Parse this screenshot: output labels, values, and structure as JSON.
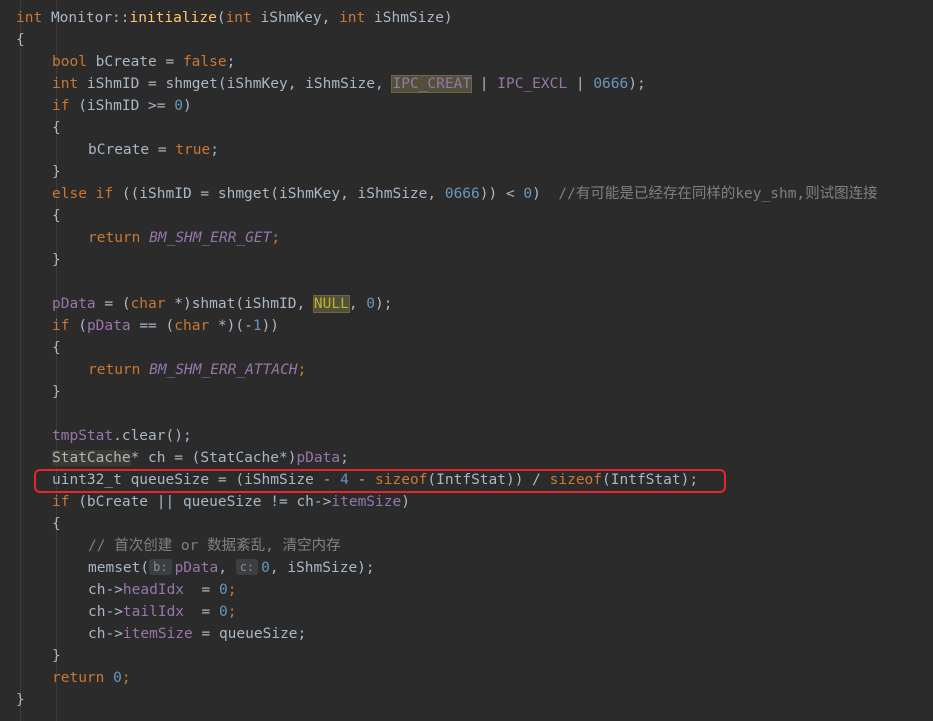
{
  "code": {
    "l1": {
      "kw1": "int",
      "cls": "Monitor::",
      "fn": "initialize",
      "p1": "(",
      "kw2": "int",
      "t1": " iShmKey, ",
      "kw3": "int",
      "t2": " iShmSize)"
    },
    "l2": {
      "t": "{"
    },
    "l3": {
      "kw": "bool",
      "t1": " bCreate = ",
      "kw2": "false",
      "t2": ";"
    },
    "l4": {
      "kw": "int",
      "t1": " iShmID = shmget(iShmKey, iShmSize, ",
      "m1": "IPC_CREAT",
      "t2": " | ",
      "m2": "IPC_EXCL",
      "t3": " | ",
      "n": "0666",
      "t4": ");"
    },
    "l5": {
      "kw": "if",
      "t1": " (iShmID >= ",
      "n": "0",
      "t2": ")"
    },
    "l6": {
      "t": "{"
    },
    "l7": {
      "t1": "bCreate = ",
      "kw": "true",
      "t2": ";"
    },
    "l8": {
      "t": "}"
    },
    "l9": {
      "kw": "else if",
      "t1": " ((iShmID = shmget(iShmKey, iShmSize, ",
      "n1": "0666",
      "t2": ")) < ",
      "n2": "0",
      "t3": ")  ",
      "c": "//有可能是已经存在同样的key_shm,则试图连接"
    },
    "l10": {
      "t": "{"
    },
    "l11": {
      "kw": "return",
      "sp": " ",
      "m": "BM_SHM_ERR_GET",
      "t": ";"
    },
    "l12": {
      "t": "}"
    },
    "l14": {
      "f": "pData",
      "t1": " = (",
      "kw": "char",
      "t2": " *)shmat(iShmID, ",
      "m": "NULL",
      "t3": ", ",
      "n": "0",
      "t4": ");"
    },
    "l15": {
      "kw": "if",
      "t1": " (",
      "f": "pData",
      "t2": " == (",
      "kw2": "char",
      "t3": " *)(-",
      "n": "1",
      "t4": "))"
    },
    "l16": {
      "t": "{"
    },
    "l17": {
      "kw": "return",
      "sp": " ",
      "m": "BM_SHM_ERR_ATTACH",
      "t": ";"
    },
    "l18": {
      "t": "}"
    },
    "l20": {
      "f": "tmpStat",
      "t": ".clear();"
    },
    "l21": {
      "ty": "StatCache",
      "t1": "* ch = (StatCache*)",
      "f": "pData",
      "t2": ";"
    },
    "l22": {
      "t1": "uint32_t queueSize = (iShmSize - ",
      "n": "4",
      "t2": " - ",
      "kw": "sizeof",
      "t3": "(IntfStat)) / ",
      "kw2": "sizeof",
      "t4": "(IntfStat);"
    },
    "l23": {
      "kw": "if",
      "t1": " (bCreate || queueSize != ch->",
      "f": "itemSize",
      "t2": ")"
    },
    "l24": {
      "t": "{"
    },
    "l25": {
      "c": "// 首次创建 or 数据紊乱, 清空内存"
    },
    "l26": {
      "t1": "memset(",
      "h1": "b:",
      "f": "pData",
      "t2": ", ",
      "h2": "c:",
      "n": "0",
      "t3": ", iShmSize);"
    },
    "l27": {
      "t1": "ch->",
      "f": "headIdx",
      "t2": "  = ",
      "n": "0",
      "t3": ";"
    },
    "l28": {
      "t1": "ch->",
      "f": "tailIdx",
      "t2": "  = ",
      "n": "0",
      "t3": ";"
    },
    "l29": {
      "t1": "ch->",
      "f": "itemSize",
      "t2": " = queueSize;"
    },
    "l30": {
      "t": "}"
    },
    "l31": {
      "kw": "return",
      "sp": " ",
      "n": "0",
      "t": ";"
    },
    "l32": {
      "t": "}"
    }
  },
  "colors": {
    "background": "#2b2b2b",
    "keyword": "#cc7832",
    "function": "#ffc66d",
    "number": "#6897bb",
    "field": "#9876aa",
    "comment": "#808080",
    "text": "#a9b7c6",
    "annotation_box": "#e5262d"
  }
}
